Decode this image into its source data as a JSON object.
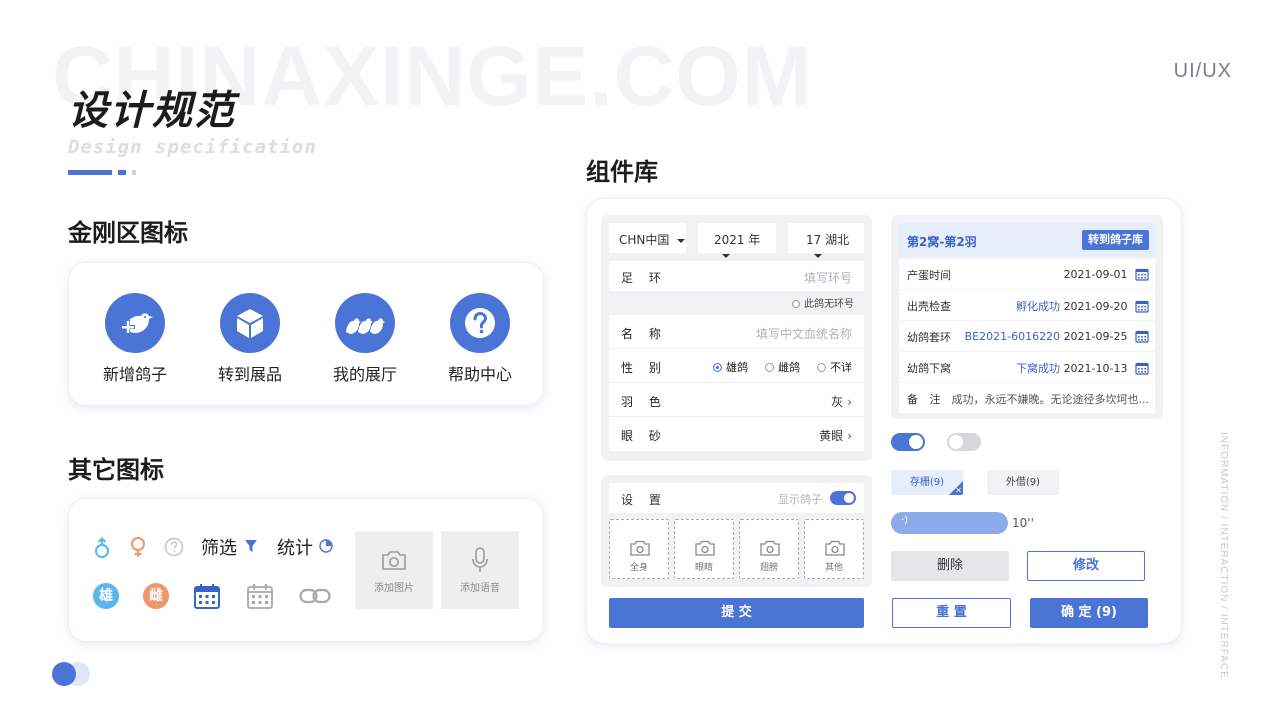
{
  "header": {
    "watermark": "CHINAXINGE.COM",
    "title": "设计规范",
    "subtitle": "Design specification",
    "tag": "UI/UX",
    "vertical_tag": "INFORMATION / INTERACTION / INTERFACE"
  },
  "kingkong": {
    "title": "金刚区图标",
    "items": [
      {
        "label": "新增鸽子",
        "icon": "add-pigeon-icon"
      },
      {
        "label": "转到展品",
        "icon": "box-icon"
      },
      {
        "label": "我的展厅",
        "icon": "pigeons-group-icon"
      },
      {
        "label": "帮助中心",
        "icon": "help-icon"
      }
    ]
  },
  "other_icons": {
    "title": "其它图标",
    "filter_label": "筛选",
    "stats_label": "统计",
    "male_badge": "雄",
    "female_badge": "雌",
    "add_photo": "添加图片",
    "add_voice": "添加语音"
  },
  "components": {
    "title": "组件库",
    "form": {
      "country": "CHN中国",
      "year": "2021 年",
      "region": "17 湖北",
      "ring_label": "足 环",
      "ring_placeholder": "填写环号",
      "no_ring": "此鸽无环号",
      "name_label": "名 称",
      "name_placeholder": "填写中文血统名称",
      "gender_label": "性 别",
      "gender_options": [
        "雄鸽",
        "雌鸽",
        "不详"
      ],
      "feather_label": "羽 色",
      "feather_value": "灰",
      "eye_label": "眼 砂",
      "eye_value": "黄眼"
    },
    "settings": {
      "label": "设 置",
      "show_pigeon": "显示鸽子",
      "slots": [
        "全身",
        "眼睛",
        "翅膀",
        "其他"
      ],
      "submit": "提 交"
    },
    "info_card": {
      "title": "第2窝-第2羽",
      "action": "转到鸽子库",
      "rows": [
        {
          "key": "产蛋时间",
          "status": "",
          "date": "2021-09-01"
        },
        {
          "key": "出壳检查",
          "status": "孵化成功",
          "date": "2021-09-20"
        },
        {
          "key": "幼鸽套环",
          "status": "BE2021-6016220",
          "date": "2021-09-25"
        },
        {
          "key": "幼鸽下窝",
          "status": "下窝成功",
          "date": "2021-10-13"
        }
      ],
      "note_key": "备 注",
      "note_value": "成功，永远不嫌晚。无论途径多坎坷也..."
    },
    "tags": {
      "stored": "存栅(9)",
      "lent": "外借(9)"
    },
    "voice_duration": "10''",
    "buttons": {
      "delete": "删除",
      "edit": "修改",
      "reset": "重 置",
      "confirm": "确 定 (9)"
    }
  },
  "colors": {
    "accent": "#4a74d6",
    "male": "#5bb6ec",
    "female": "#f1966b",
    "calendar": "#3a63c8"
  }
}
